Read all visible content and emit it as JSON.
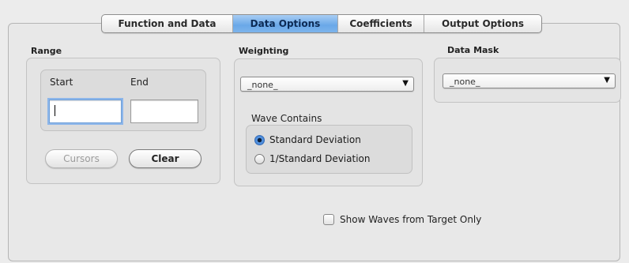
{
  "tabs": [
    {
      "label": "Function and Data",
      "active": false
    },
    {
      "label": "Data Options",
      "active": true
    },
    {
      "label": "Coefficients",
      "active": false
    },
    {
      "label": "Output Options",
      "active": false
    }
  ],
  "range": {
    "title": "Range",
    "start_label": "Start",
    "end_label": "End",
    "start_value": "",
    "end_value": "",
    "cursors_label": "Cursors",
    "clear_label": "Clear"
  },
  "weighting": {
    "title": "Weighting",
    "selected": "_none_",
    "wave_contains": {
      "title": "Wave Contains",
      "options": [
        "Standard Deviation",
        "1/Standard Deviation"
      ],
      "selected_index": 0
    }
  },
  "data_mask": {
    "title": "Data Mask",
    "selected": "_none_"
  },
  "show_waves": {
    "label": "Show Waves from Target Only",
    "checked": false
  },
  "icons": {
    "popup_arrow": "triangle-down-icon"
  },
  "colors": {
    "active_tab": "#7fb3ec",
    "focus_ring": "#8cb6ea",
    "radio_selected": "#2f6fc8"
  }
}
